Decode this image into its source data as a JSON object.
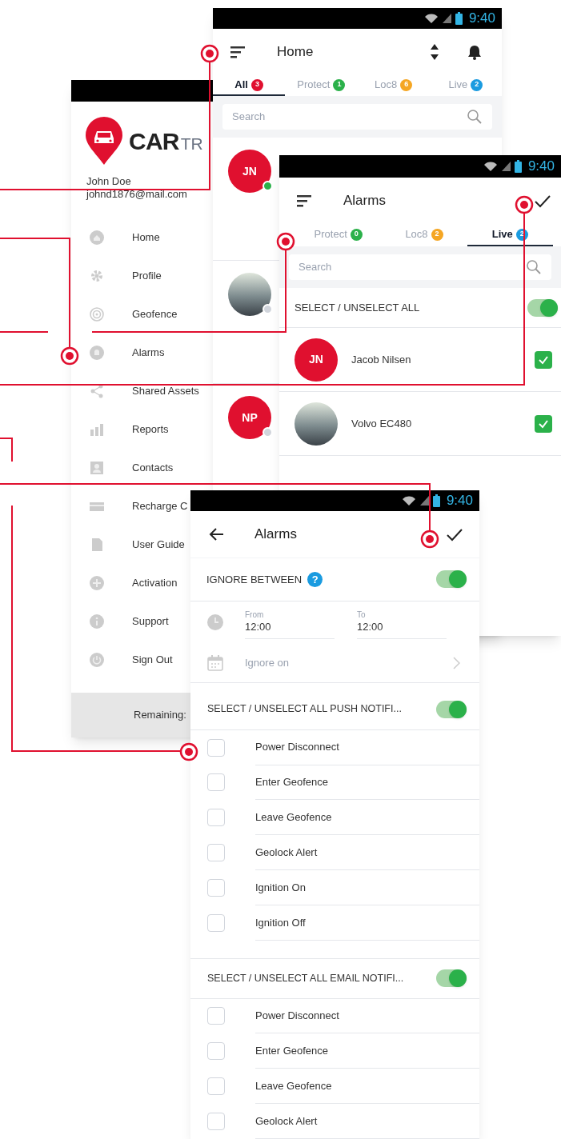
{
  "home_screen": {
    "status_time": "9:40",
    "title": "Home",
    "tabs": [
      {
        "label": "All",
        "count": "3",
        "color": "#e0102f",
        "selected": true
      },
      {
        "label": "Protect",
        "count": "1",
        "color": "#2bb14a",
        "selected": false
      },
      {
        "label": "Loc8",
        "count": "6",
        "color": "#f5a623",
        "selected": false
      },
      {
        "label": "Live",
        "count": "2",
        "color": "#1a9be0",
        "selected": false
      }
    ],
    "search": {
      "placeholder": "Search"
    },
    "vehicles": [
      {
        "kind": "initials",
        "initials": "JN",
        "online": true
      },
      {
        "kind": "photo",
        "online": false
      },
      {
        "kind": "initials",
        "initials": "NP",
        "online": false
      }
    ]
  },
  "drawer": {
    "logo_bold": "CAR",
    "logo_light": "TR",
    "user_name": "John Doe",
    "email": "johnd1876@mail.com",
    "items": [
      {
        "label": "Home"
      },
      {
        "label": "Profile"
      },
      {
        "label": "Geofence"
      },
      {
        "label": "Alarms"
      },
      {
        "label": "Shared Assets"
      },
      {
        "label": "Reports"
      },
      {
        "label": "Contacts"
      },
      {
        "label": "Recharge C"
      },
      {
        "label": "User Guide"
      },
      {
        "label": "Activation"
      },
      {
        "label": "Support"
      },
      {
        "label": "Sign Out"
      }
    ],
    "footer": "Remaining:"
  },
  "alarms_list_screen": {
    "status_time": "9:40",
    "title": "Alarms",
    "tabs": [
      {
        "label": "Protect",
        "count": "0",
        "color": "#2bb14a",
        "selected": false
      },
      {
        "label": "Loc8",
        "count": "2",
        "color": "#f5a623",
        "selected": false
      },
      {
        "label": "Live",
        "count": "2",
        "color": "#1a9be0",
        "selected": true
      }
    ],
    "search": {
      "placeholder": "Search"
    },
    "select_all": {
      "label": "SELECT / UNSELECT ALL",
      "on": true
    },
    "vehicles": [
      {
        "kind": "initials",
        "initials": "JN",
        "name": "Jacob Nilsen",
        "checked": true
      },
      {
        "kind": "photo",
        "name": "Volvo EC480",
        "checked": true
      }
    ]
  },
  "alarm_settings_screen": {
    "status_time": "9:40",
    "title": "Alarms",
    "ignore_between": {
      "label": "IGNORE BETWEEN",
      "help": "?",
      "on": true
    },
    "from": {
      "label": "From",
      "value": "12:00"
    },
    "to": {
      "label": "To",
      "value": "12:00"
    },
    "ignore_on": {
      "placeholder": "Ignore on"
    },
    "sections": [
      {
        "label": "SELECT / UNSELECT ALL PUSH NOTIFI...",
        "on": true,
        "items": [
          {
            "label": "Power Disconnect",
            "checked": false
          },
          {
            "label": "Enter Geofence",
            "checked": false
          },
          {
            "label": "Leave Geofence",
            "checked": false
          },
          {
            "label": "Geolock Alert",
            "checked": false
          },
          {
            "label": "Ignition On",
            "checked": false
          },
          {
            "label": "Ignition Off",
            "checked": false
          }
        ]
      },
      {
        "label": "SELECT / UNSELECT ALL EMAIL NOTIFI...",
        "on": true,
        "items": [
          {
            "label": "Power Disconnect",
            "checked": false
          },
          {
            "label": "Enter Geofence",
            "checked": false
          },
          {
            "label": "Leave Geofence",
            "checked": false
          },
          {
            "label": "Geolock Alert",
            "checked": false
          }
        ]
      }
    ]
  }
}
